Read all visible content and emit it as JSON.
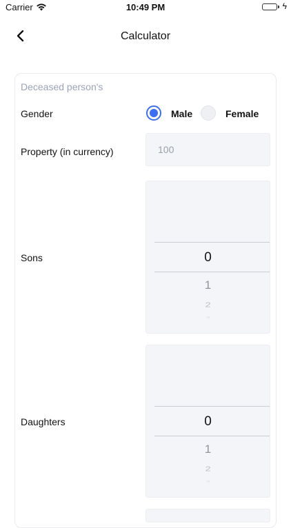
{
  "status_bar": {
    "carrier": "Carrier",
    "time": "10:49 PM"
  },
  "nav": {
    "title": "Calculator",
    "back_icon": "chevron-left-icon"
  },
  "form": {
    "section_label": "Deceased person's",
    "gender": {
      "label": "Gender",
      "options": [
        {
          "label": "Male",
          "selected": true
        },
        {
          "label": "Female",
          "selected": false
        }
      ]
    },
    "property": {
      "label": "Property (in currency)",
      "placeholder": "100"
    },
    "sons": {
      "label": "Sons",
      "selected": "0",
      "next": [
        "1",
        "2",
        "3"
      ]
    },
    "daughters": {
      "label": "Daughters",
      "selected": "0",
      "next": [
        "1",
        "2",
        "3"
      ]
    }
  },
  "colors": {
    "accent": "#3b6ef5",
    "section_label": "#9aa3b5",
    "field_bg": "#f4f5f8",
    "battery": "#34c759"
  }
}
